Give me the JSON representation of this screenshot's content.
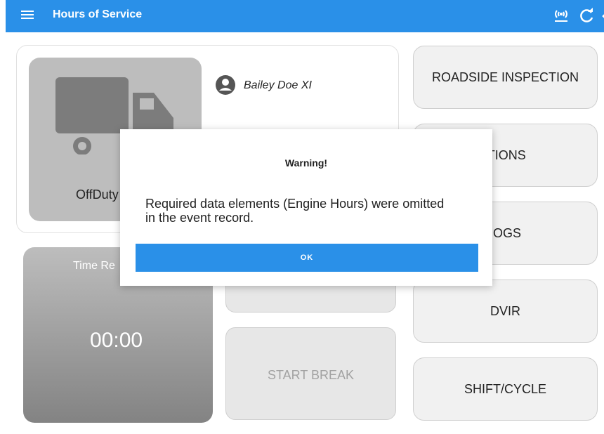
{
  "header": {
    "title": "Hours of Service",
    "icons": [
      "menu-icon",
      "eld-connection-icon",
      "refresh-icon",
      "logout-icon"
    ]
  },
  "status": {
    "label": "OffDuty",
    "driver_name": "Bailey Doe XI"
  },
  "time_remaining": {
    "label": "Time Re",
    "value": "00:00"
  },
  "middle": {
    "start_break_label": "START BREAK"
  },
  "right_buttons": [
    {
      "label": "ROADSIDE INSPECTION"
    },
    {
      "label": "'TIONS"
    },
    {
      "label": ".OGS"
    },
    {
      "label": "DVIR"
    },
    {
      "label": "SHIFT/CYCLE"
    }
  ],
  "dialog": {
    "title": "Warning!",
    "message": "Required data elements (Engine Hours) were omitted in the event record.",
    "ok_label": "OK"
  },
  "colors": {
    "primary": "#2a90e8",
    "tile_gray": "#bdbdbd",
    "button_bg": "#f1f1f1"
  }
}
